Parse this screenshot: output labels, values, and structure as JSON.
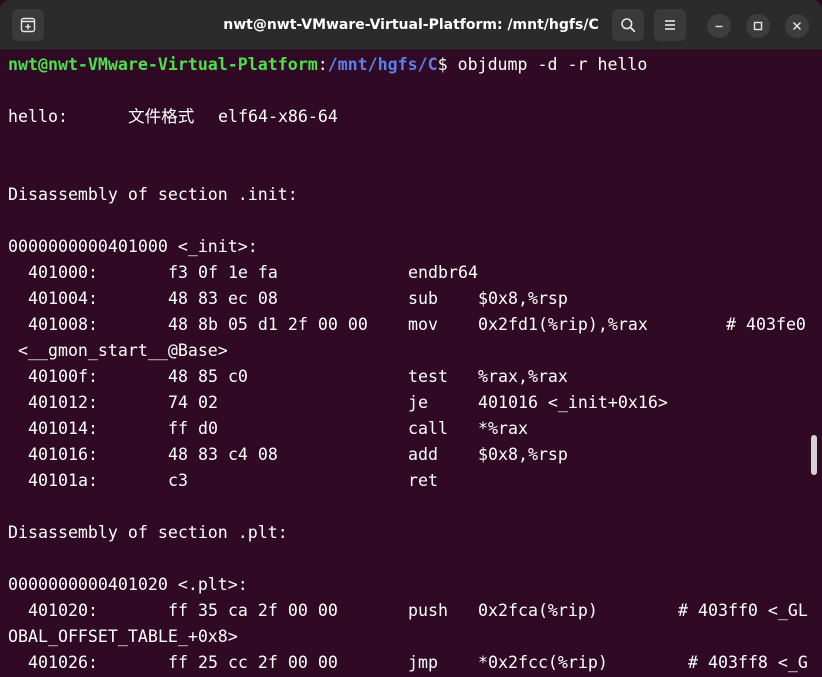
{
  "window": {
    "title": "nwt@nwt-VMware-Virtual-Platform: /mnt/hgfs/C"
  },
  "prompt": {
    "user_host": "nwt@nwt-VMware-Virtual-Platform",
    "colon": ":",
    "path": "/mnt/hgfs/C",
    "dollar": "$",
    "command": " objdump -d -r hello"
  },
  "file_line": {
    "name": "hello:",
    "format_label": "文件格式",
    "format": "elf64-x86-64"
  },
  "sections": {
    "init_header": "Disassembly of section .init:",
    "init_symbol": "0000000000401000 <_init>:",
    "plt_header": "Disassembly of section .plt:",
    "plt_symbol": "0000000000401020 <.plt>:"
  },
  "init_rows": [
    {
      "addr": "401000:",
      "bytes": "f3 0f 1e fa",
      "mnem": "endbr64",
      "ops": "",
      "comment": ""
    },
    {
      "addr": "401004:",
      "bytes": "48 83 ec 08",
      "mnem": "sub",
      "ops": "$0x8,%rsp",
      "comment": ""
    },
    {
      "addr": "401008:",
      "bytes": "48 8b 05 d1 2f 00 00",
      "mnem": "mov",
      "ops": "0x2fd1(%rip),%rax",
      "comment": "# 403fe0"
    },
    {
      "addr": "40100f:",
      "bytes": "48 85 c0",
      "mnem": "test",
      "ops": "%rax,%rax",
      "comment": ""
    },
    {
      "addr": "401012:",
      "bytes": "74 02",
      "mnem": "je",
      "ops": "401016 <_init+0x16>",
      "comment": ""
    },
    {
      "addr": "401014:",
      "bytes": "ff d0",
      "mnem": "call",
      "ops": "*%rax",
      "comment": ""
    },
    {
      "addr": "401016:",
      "bytes": "48 83 c4 08",
      "mnem": "add",
      "ops": "$0x8,%rsp",
      "comment": ""
    },
    {
      "addr": "40101a:",
      "bytes": "c3",
      "mnem": "ret",
      "ops": "",
      "comment": ""
    }
  ],
  "wrap_lines": {
    "gmon": " <__gmon_start__@Base>",
    "got": "OBAL_OFFSET_TABLE_+0x8>"
  },
  "plt_rows": [
    {
      "addr": "401020:",
      "bytes": "ff 35 ca 2f 00 00",
      "mnem": "push",
      "ops": "0x2fca(%rip)",
      "comment": "# 403ff0 <_GL"
    },
    {
      "addr": "401026:",
      "bytes": "ff 25 cc 2f 00 00",
      "mnem": "jmp",
      "ops": "*0x2fcc(%rip)",
      "comment": "# 403ff8 <_G"
    }
  ],
  "icons": {
    "new_tab": "new-tab-icon",
    "search": "search-icon",
    "menu": "hamburger-menu-icon",
    "minimize": "minimize-icon",
    "maximize": "maximize-icon",
    "close": "close-icon"
  },
  "colors": {
    "background": "#300a24",
    "prompt_user": "#4ce04c",
    "prompt_path": "#5b80e8",
    "text": "#ffffff"
  }
}
